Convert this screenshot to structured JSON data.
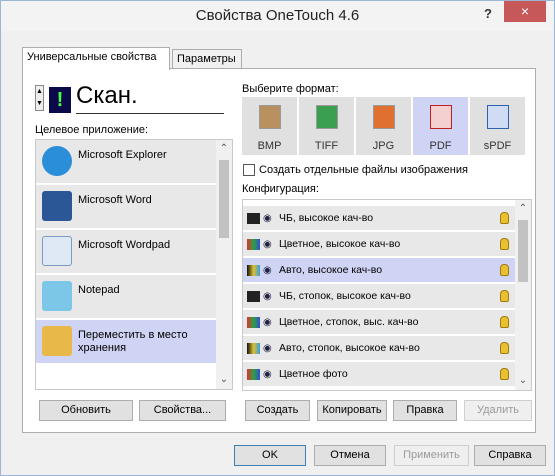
{
  "window": {
    "title": "Свойства OneTouch 4.6",
    "help_label": "?",
    "close_label": "×"
  },
  "tabs": [
    {
      "label": "Универсальные свойства"
    },
    {
      "label": "Параметры"
    }
  ],
  "scan": {
    "button_icon_text": "!",
    "title": "Скан.",
    "spinner_up": "▲",
    "spinner_down": "▼"
  },
  "target": {
    "label": "Целевое приложение:",
    "apps": [
      {
        "label": "Microsoft Explorer",
        "icon": "ie-icon"
      },
      {
        "label": "Microsoft Word",
        "icon": "word-icon"
      },
      {
        "label": "Microsoft Wordpad",
        "icon": "wordpad-icon"
      },
      {
        "label": "Notepad",
        "icon": "notepad-icon"
      },
      {
        "label": "Переместить в место хранения",
        "icon": "storage-folder-icon"
      }
    ],
    "selected_index": 4
  },
  "format": {
    "label": "Выберите формат:",
    "items": [
      {
        "label": "BMP",
        "color": "#8a6a3a"
      },
      {
        "label": "TIFF",
        "color": "#3aa050"
      },
      {
        "label": "JPG",
        "color": "#e07030"
      },
      {
        "label": "PDF",
        "color": "#c02020"
      },
      {
        "label": "sPDF",
        "color": "#3060b0"
      }
    ],
    "selected_index": 3,
    "separate_files_label": "Создать отдельные файлы изображения"
  },
  "config": {
    "label": "Конфигурация:",
    "items": [
      {
        "label": "ЧБ, высокое кач-во"
      },
      {
        "label": "Цветное, высокое кач-во"
      },
      {
        "label": "Авто, высокое кач-во"
      },
      {
        "label": "ЧБ, стопок, высокое кач-во"
      },
      {
        "label": "Цветное, стопок, выс. кач-во"
      },
      {
        "label": "Авто, стопок, высокое кач-во"
      },
      {
        "label": "Цветное фото"
      }
    ],
    "selected_index": 2
  },
  "buttons": {
    "refresh": "Обновить",
    "properties": "Свойства...",
    "create": "Создать",
    "copy": "Копировать",
    "edit": "Правка",
    "delete": "Удалить",
    "ok": "OK",
    "cancel": "Отмена",
    "apply": "Применить",
    "help": "Справка"
  },
  "colors": {
    "selection": "#cfd3f4",
    "close_button": "#c7585a"
  }
}
